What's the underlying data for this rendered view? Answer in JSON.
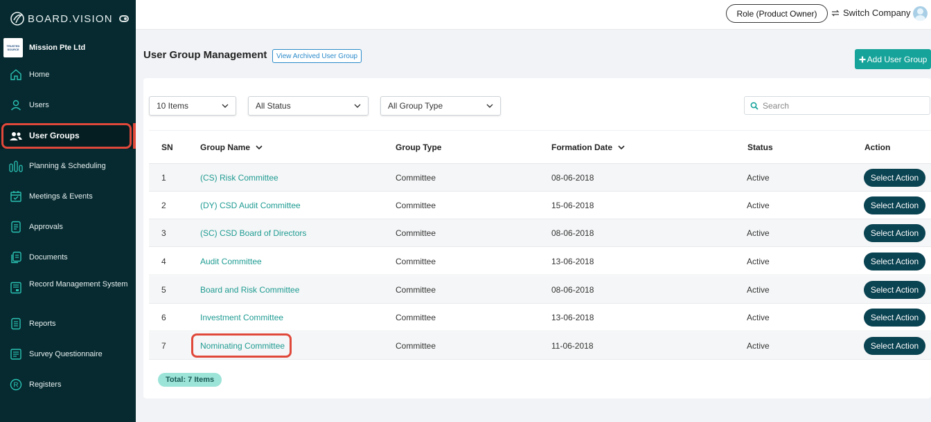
{
  "app": {
    "logo_text": "BOARD.VISION"
  },
  "company": {
    "name": "Mission Pte Ltd",
    "logo_text": "TRUSTED SOURCE"
  },
  "sidebar": {
    "items": [
      {
        "label": "Home",
        "icon": "home-icon"
      },
      {
        "label": "Users",
        "icon": "user-icon"
      },
      {
        "label": "User Groups",
        "icon": "user-group-icon",
        "active": true
      },
      {
        "label": "Planning & Scheduling",
        "icon": "bar-chart-icon"
      },
      {
        "label": "Meetings & Events",
        "icon": "calendar-icon"
      },
      {
        "label": "Approvals",
        "icon": "document-check-icon"
      },
      {
        "label": "Documents",
        "icon": "documents-icon"
      },
      {
        "label": "Record Management System",
        "icon": "record-icon"
      },
      {
        "label": "Reports",
        "icon": "report-icon"
      },
      {
        "label": "Survey Questionnaire",
        "icon": "survey-icon"
      },
      {
        "label": "Registers",
        "icon": "registered-icon"
      }
    ]
  },
  "topbar": {
    "role_label": "Role (Product Owner)",
    "switch_label": "Switch Company"
  },
  "header": {
    "title": "User Group Management",
    "archived_link": "View Archived User Group",
    "add_button": "Add User Group"
  },
  "filters": {
    "items_per_page": "10 Items",
    "status": "All Status",
    "group_type": "All Group Type",
    "search_placeholder": "Search"
  },
  "table": {
    "columns": [
      "SN",
      "Group Name",
      "Group Type",
      "Formation Date",
      "Status",
      "Action"
    ],
    "action_label": "Select Action",
    "rows": [
      {
        "sn": "1",
        "name": "(CS) Risk Committee",
        "type": "Committee",
        "date": "08-06-2018",
        "status": "Active"
      },
      {
        "sn": "2",
        "name": "(DY) CSD Audit Committee",
        "type": "Committee",
        "date": "15-06-2018",
        "status": "Active"
      },
      {
        "sn": "3",
        "name": "(SC) CSD Board of Directors",
        "type": "Committee",
        "date": "08-06-2018",
        "status": "Active"
      },
      {
        "sn": "4",
        "name": "Audit Committee",
        "type": "Committee",
        "date": "13-06-2018",
        "status": "Active"
      },
      {
        "sn": "5",
        "name": "Board and Risk Committee",
        "type": "Committee",
        "date": "08-06-2018",
        "status": "Active"
      },
      {
        "sn": "6",
        "name": "Investment Committee",
        "type": "Committee",
        "date": "13-06-2018",
        "status": "Active"
      },
      {
        "sn": "7",
        "name": "Nominating Committee",
        "type": "Committee",
        "date": "11-06-2018",
        "status": "Active"
      }
    ]
  },
  "footer": {
    "total_label": "Total: 7 Items"
  },
  "colors": {
    "sidebar_bg": "#062a30",
    "accent": "#16a39a",
    "action_button": "#0a4352",
    "highlight": "#e0483a"
  }
}
